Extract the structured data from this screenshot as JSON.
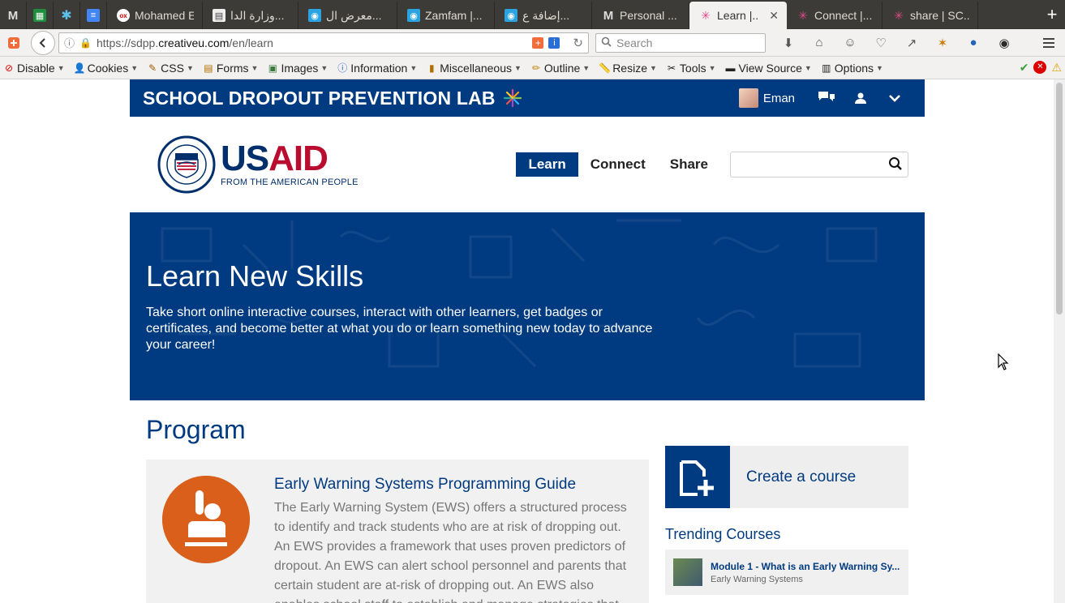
{
  "browser": {
    "tabs": [
      {
        "title": "",
        "icon": "gmail-icon",
        "pinned": true
      },
      {
        "title": "",
        "icon": "sheets-icon",
        "pinned": true
      },
      {
        "title": "",
        "icon": "asterisk-icon",
        "pinned": true
      },
      {
        "title": "",
        "icon": "docs-icon",
        "pinned": true
      },
      {
        "title": "Mohamed El...",
        "icon": "olx-icon"
      },
      {
        "title": "وزارة الدا...",
        "icon": "document-icon"
      },
      {
        "title": "معرض ال...",
        "icon": "target-icon"
      },
      {
        "title": "Zamfam |...",
        "icon": "target-icon"
      },
      {
        "title": "إضافة ع...",
        "icon": "target-icon"
      },
      {
        "title": "Personal ...",
        "icon": "gmail-icon"
      },
      {
        "title": "Learn |...",
        "icon": "burst-icon",
        "active": true
      },
      {
        "title": "Connect |...",
        "icon": "burst-icon"
      },
      {
        "title": "share | SC...",
        "icon": "burst-icon"
      }
    ],
    "new_tab_label": "+",
    "url_scheme": "https://sdpp.",
    "url_domain": "creativeu.com",
    "url_path": "/en/learn",
    "search_placeholder": "Search"
  },
  "devtoolbar": {
    "items": [
      {
        "label": "Disable",
        "icon": "disable-icon"
      },
      {
        "label": "Cookies",
        "icon": "cookies-icon"
      },
      {
        "label": "CSS",
        "icon": "css-icon"
      },
      {
        "label": "Forms",
        "icon": "forms-icon"
      },
      {
        "label": "Images",
        "icon": "images-icon"
      },
      {
        "label": "Information",
        "icon": "information-icon"
      },
      {
        "label": "Miscellaneous",
        "icon": "miscellaneous-icon"
      },
      {
        "label": "Outline",
        "icon": "outline-icon"
      },
      {
        "label": "Resize",
        "icon": "resize-icon"
      },
      {
        "label": "Tools",
        "icon": "tools-icon"
      },
      {
        "label": "View Source",
        "icon": "view-source-icon"
      },
      {
        "label": "Options",
        "icon": "options-icon"
      }
    ]
  },
  "site": {
    "name": "SCHOOL DROPOUT PREVENTION LAB",
    "user_name": "Eman",
    "logo_word_us": "US",
    "logo_word_aid": "AID",
    "logo_tagline": "FROM THE AMERICAN PEOPLE",
    "nav": [
      {
        "label": "Learn",
        "active": true
      },
      {
        "label": "Connect"
      },
      {
        "label": "Share"
      }
    ],
    "search_value": ""
  },
  "hero": {
    "title": "Learn New Skills",
    "description": "Take short online interactive courses, interact with other learners, get badges or certificates, and become better at what you do or learn something new today to advance your career!"
  },
  "program": {
    "section_title": "Program",
    "card": {
      "title": "Early Warning Systems Programming Guide",
      "description": "The Early Warning System (EWS) offers a structured process to identify and track students who are at risk of dropping out. An EWS provides a framework that uses proven predictors of dropout. An EWS can alert school personnel and parents that certain student are at-risk of dropping out. An EWS also enables school staff to establish and manage strategies that"
    }
  },
  "sidebar": {
    "create_label": "Create a course",
    "trending_title": "Trending Courses",
    "trending": [
      {
        "name": "Module 1 - What is an Early Warning Sy...",
        "category": "Early Warning Systems"
      }
    ]
  },
  "colors": {
    "brand_blue": "#003a80",
    "usaid_red": "#ba0c2f",
    "program_orange": "#d95f1b"
  }
}
